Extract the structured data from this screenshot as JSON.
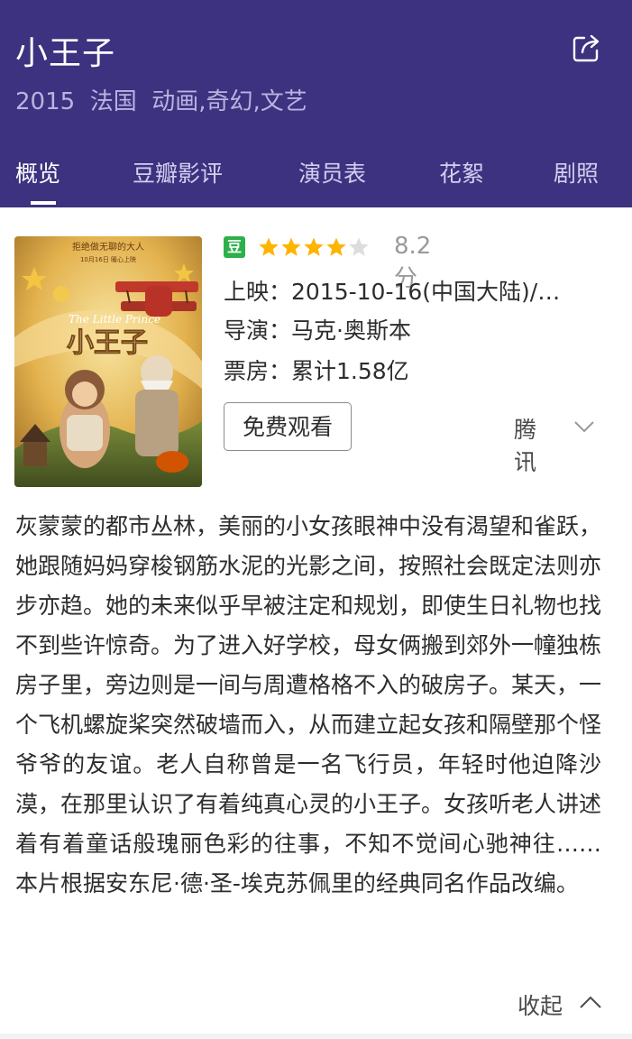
{
  "header": {
    "title": "小王子",
    "meta": "2015  法国  动画,奇幻,文艺",
    "share_icon": "share-icon",
    "colors": {
      "background": "#3c327f",
      "meta_text": "#b9b3e2"
    }
  },
  "tabs": [
    {
      "label": "概览",
      "active": true
    },
    {
      "label": "豆瓣影评",
      "active": false
    },
    {
      "label": "演员表",
      "active": false
    },
    {
      "label": "花絮",
      "active": false
    },
    {
      "label": "剧照",
      "active": false
    }
  ],
  "poster": {
    "top_text_1": "拒绝做无聊的大人",
    "top_text_2": "10月16日  暖心上映",
    "subtitle_en": "The Little Prince",
    "title_cn": "小王子"
  },
  "rating": {
    "badge": "豆",
    "score_text": "8.2分",
    "stars_filled": 4,
    "stars_total": 5,
    "colors": {
      "star_filled": "#ffb400",
      "star_empty": "#dddddd",
      "badge": "#2db04b"
    }
  },
  "details": {
    "release": "上映：2015-10-16(中国大陆)/…",
    "director": "导演：马克·奥斯本",
    "box_office": "票房：累计1.58亿"
  },
  "actions": {
    "watch_label": "免费观看",
    "provider_label": "腾讯"
  },
  "description": "灰蒙蒙的都市丛林，美丽的小女孩眼神中没有渴望和雀跃，她跟随妈妈穿梭钢筋水泥的光影之间，按照社会既定法则亦步亦趋。她的未来似乎早被注定和规划，即使生日礼物也找不到些许惊奇。为了进入好学校，母女俩搬到郊外一幢独栋房子里，旁边则是一间与周遭格格不入的破房子。某天，一个飞机螺旋桨突然破墙而入，从而建立起女孩和隔壁那个怪爷爷的友谊。老人自称曾是一名飞行员，年轻时他迫降沙漠，在那里认识了有着纯真心灵的小王子。女孩听老人讲述着有着童话般瑰丽色彩的往事，不知不觉间心驰神往…… 本片根据安东尼·德·圣-埃克苏佩里的经典同名作品改编。",
  "collapse_label": "收起"
}
